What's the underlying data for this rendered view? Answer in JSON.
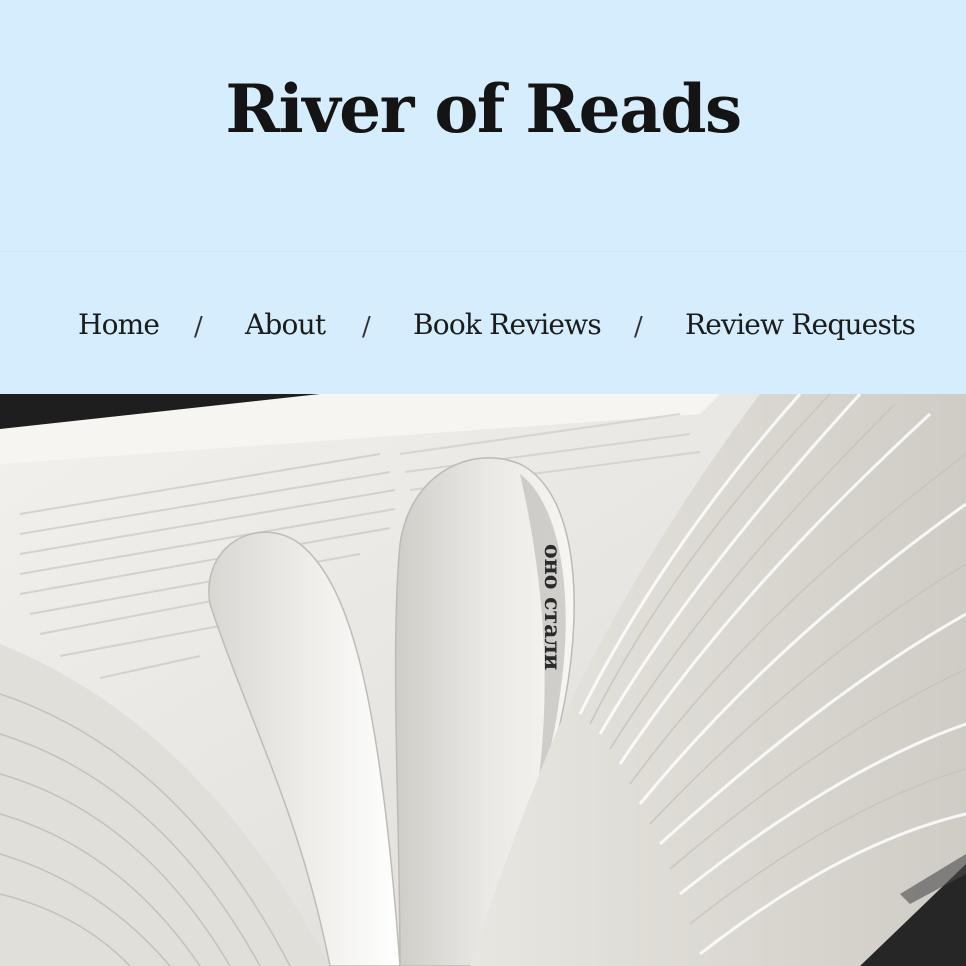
{
  "site": {
    "title": "River of Reads"
  },
  "nav": {
    "items": [
      {
        "label": "Home"
      },
      {
        "label": "About"
      },
      {
        "label": "Book Reviews"
      },
      {
        "label": "Review Requests"
      }
    ],
    "separator": "/"
  },
  "hero": {
    "image_subject": "open book with pages folded into a heart",
    "page_text": "оно стали"
  },
  "colors": {
    "background": "#d5edfc",
    "text": "#1c1c1c"
  }
}
